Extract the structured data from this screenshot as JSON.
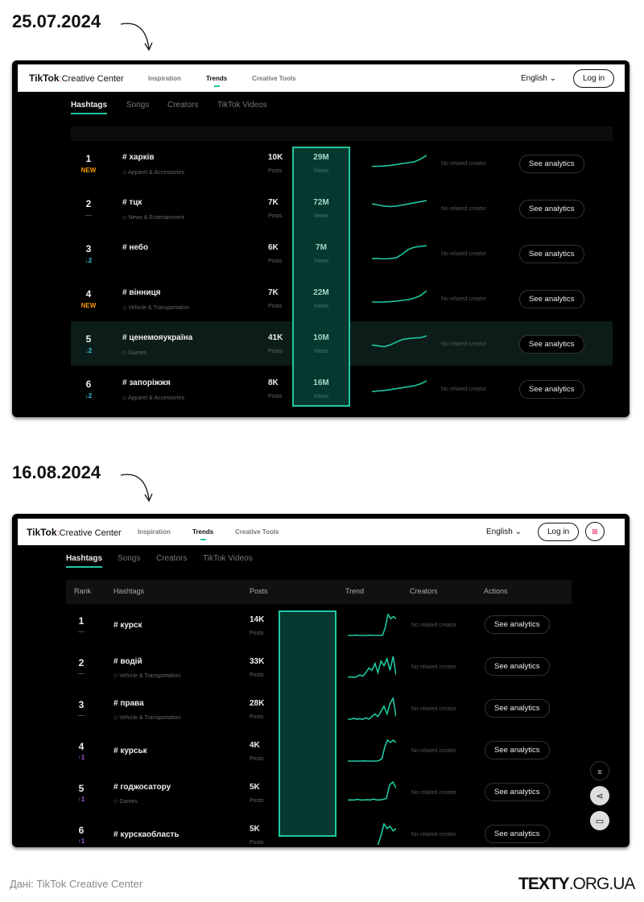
{
  "dates": [
    "25.07.2024",
    "16.08.2024"
  ],
  "nav": {
    "logo": "TikTok",
    "logo_sub": "Creative Center",
    "items": [
      "Inspiration",
      "Trends",
      "Creative Tools"
    ],
    "active": "Trends",
    "language": "English ⌄",
    "login": "Log in"
  },
  "tabs": [
    "Hashtags",
    "Songs",
    "Creators",
    "TikTok Videos"
  ],
  "labels": {
    "posts": "Posts",
    "views": "Views",
    "no_creator": "No related creator",
    "see_analytics": "See analytics"
  },
  "table_headers": [
    "Rank",
    "Hashtags",
    "Posts",
    "Trend",
    "Creators",
    "Actions"
  ],
  "colors": {
    "accent": "#1fc8a0",
    "highlight_box": "#06382f",
    "new": "#f59a00",
    "down": "#2cc6d6",
    "up": "#9b59d9"
  },
  "panel1_rows": [
    {
      "rank": "1",
      "change": "NEW",
      "change_type": "new",
      "tag": "# харків",
      "category": "Apparel & Accessories",
      "posts": "10K",
      "views": "29M",
      "trend": [
        2,
        2,
        2.2,
        2.5,
        3,
        3.5,
        4,
        4.5,
        6,
        8
      ]
    },
    {
      "rank": "2",
      "change": "—",
      "change_type": "same",
      "tag": "# тцк",
      "category": "News & Entertainment",
      "posts": "7K",
      "views": "72M",
      "trend": [
        5,
        4.5,
        4,
        3.8,
        4,
        4.5,
        5,
        5.5,
        6,
        6.5
      ]
    },
    {
      "rank": "3",
      "change": "↓2",
      "change_type": "down",
      "tag": "# небо",
      "category": "",
      "posts": "6K",
      "views": "7M",
      "trend": [
        1,
        1,
        0.8,
        1,
        1.5,
        4,
        7,
        8.5,
        9,
        9.5
      ]
    },
    {
      "rank": "4",
      "change": "NEW",
      "change_type": "new",
      "tag": "# вінниця",
      "category": "Vehicle & Transportation",
      "posts": "7K",
      "views": "22M",
      "trend": [
        2,
        2,
        2,
        2.2,
        2.5,
        3,
        3.5,
        4.5,
        6,
        9
      ]
    },
    {
      "rank": "5",
      "change": "↓2",
      "change_type": "down",
      "tag": "# ценемояукраїна",
      "category": "Games",
      "posts": "41K",
      "views": "10M",
      "trend": [
        3,
        2.5,
        2,
        3,
        4.5,
        6,
        6.5,
        6.8,
        7,
        8
      ]
    },
    {
      "rank": "6",
      "change": "↓2",
      "change_type": "down",
      "tag": "# запоріжжя",
      "category": "Apparel & Accessories",
      "posts": "8K",
      "views": "16M",
      "trend": [
        2,
        2.3,
        2.6,
        3,
        3.5,
        4,
        4.5,
        5,
        6,
        7.5
      ]
    }
  ],
  "panel2_rows": [
    {
      "rank": "1",
      "change": "—",
      "change_type": "same",
      "tag": "# курск",
      "category": "",
      "posts": "14K",
      "trend": [
        0,
        0,
        0,
        0.1,
        0,
        0,
        0,
        0,
        0.1,
        0,
        0,
        0,
        0,
        0.1,
        4,
        10,
        8,
        9,
        8
      ]
    },
    {
      "rank": "2",
      "change": "—",
      "change_type": "same",
      "tag": "# водій",
      "category": "Vehicle & Transportation",
      "posts": "33K",
      "trend": [
        0,
        0.2,
        0,
        0.3,
        1,
        0.5,
        2,
        4,
        3,
        6,
        2,
        7,
        5,
        8,
        3,
        9,
        1
      ]
    },
    {
      "rank": "3",
      "change": "—",
      "change_type": "same",
      "tag": "# права",
      "category": "Vehicle & Transportation",
      "posts": "28K",
      "trend": [
        0,
        0,
        0.3,
        0,
        0.2,
        0,
        0.5,
        0,
        1,
        2,
        1,
        3,
        5,
        2,
        6,
        8,
        1
      ]
    },
    {
      "rank": "4",
      "change": "↑1",
      "change_type": "up",
      "tag": "# курськ",
      "category": "",
      "posts": "4K",
      "trend": [
        0,
        0,
        0,
        0,
        0,
        0,
        0.1,
        0,
        0,
        0,
        0,
        0.2,
        1,
        6,
        9,
        8,
        9,
        8
      ]
    },
    {
      "rank": "5",
      "change": "↑1",
      "change_type": "up",
      "tag": "# годжосатору",
      "category": "Games",
      "posts": "5K",
      "trend": [
        1,
        1,
        1,
        1.2,
        1,
        1,
        1.1,
        1,
        1.3,
        1,
        1,
        1.2,
        1.5,
        6,
        7,
        5
      ]
    },
    {
      "rank": "6",
      "change": "↑1",
      "change_type": "up",
      "tag": "# курскаобласть",
      "category": "",
      "posts": "5K",
      "trend": [
        null,
        null,
        null,
        null,
        null,
        null,
        null,
        null,
        null,
        null,
        0,
        4,
        9,
        7,
        8,
        6,
        7
      ]
    }
  ],
  "footer": {
    "source": "Дані: TikTok Creative Center",
    "brand_bold": "TEXTY",
    "brand_rest": ".ORG.UA"
  }
}
